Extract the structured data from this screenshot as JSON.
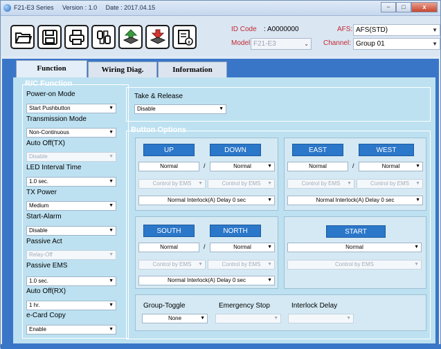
{
  "titlebar": {
    "series": "F21-E3 Series",
    "version": "Version : 1.0",
    "date": "Date : 2017.04.15",
    "minimize": "−",
    "maximize": "□",
    "close": "x"
  },
  "toolbar": {
    "buttons": [
      "open-folder",
      "save",
      "print",
      "connect-cable",
      "upload-chip",
      "download-chip",
      "info-doc"
    ]
  },
  "header": {
    "id_code_label": "ID Code",
    "id_code_value": ":  A0000000",
    "model_label": "Model:",
    "model_value": "F21-E3",
    "afs_label": "AFS:",
    "afs_value": "AFS(STD)",
    "channel_label": "Channel:",
    "channel_value": "Group 01"
  },
  "tabs": [
    {
      "label": "Function"
    },
    {
      "label": "Wiring Diag."
    },
    {
      "label": "Information"
    }
  ],
  "rc_function": {
    "title": "R/C Function",
    "fields": [
      {
        "label": "Power-on Mode",
        "value": "Start Pushbutton",
        "disabled": false
      },
      {
        "label": "Transmission Mode",
        "value": "Non-Continuous",
        "disabled": false
      },
      {
        "label": "Auto Off(TX)",
        "value": "Disable",
        "disabled": true
      },
      {
        "label": "LED Interval Time",
        "value": "1.0 sec.",
        "disabled": false
      },
      {
        "label": "TX Power",
        "value": "Medium",
        "disabled": false
      },
      {
        "label": "Start-Alarm",
        "value": "Disable",
        "disabled": false
      },
      {
        "label": "Passive Act",
        "value": "Relay-Off",
        "disabled": true
      },
      {
        "label": "Passive EMS",
        "value": "1.0 sec.",
        "disabled": false
      },
      {
        "label": "Auto Off(RX)",
        "value": "1 hr.",
        "disabled": false
      },
      {
        "label": "e-Card Copy",
        "value": "Enable",
        "disabled": false
      }
    ]
  },
  "take_release": {
    "label": "Take & Release",
    "value": "Disable"
  },
  "button_options": {
    "title": "Button Options",
    "pair_updown": {
      "left": "UP",
      "right": "DOWN",
      "mode_left": "Normal",
      "slash": "/",
      "mode_right": "Normal",
      "ctrl_left": "Control by EMS",
      "ctrl_right": "Control by EMS",
      "interlock": "Normal Interlock(A) Delay   0 sec"
    },
    "pair_eastwest": {
      "left": "EAST",
      "right": "WEST",
      "mode_left": "Normal",
      "slash": "/",
      "mode_right": "Normal",
      "ctrl_left": "Control by EMS",
      "ctrl_right": "Control by EMS",
      "interlock": "Normal Interlock(A) Delay   0 sec"
    },
    "pair_southnorth": {
      "left": "SOUTH",
      "right": "NORTH",
      "mode_left": "Normal",
      "slash": "/",
      "mode_right": "Normal",
      "ctrl_left": "Control by EMS",
      "ctrl_right": "Control by EMS",
      "interlock": "Normal Interlock(A) Delay   0 sec"
    },
    "start": {
      "label": "START",
      "mode": "Normal",
      "ctrl": "Control by EMS"
    },
    "group_toggle": {
      "label": "Group-Toggle",
      "value": "None"
    },
    "emergency_stop": {
      "label": "Emergency Stop",
      "value": ""
    },
    "interlock_delay": {
      "label": "Interlock Delay",
      "value": ""
    }
  },
  "colors": {
    "accent": "#2b77c9",
    "panel": "#bde1f1",
    "label_red": "#c0282d"
  }
}
